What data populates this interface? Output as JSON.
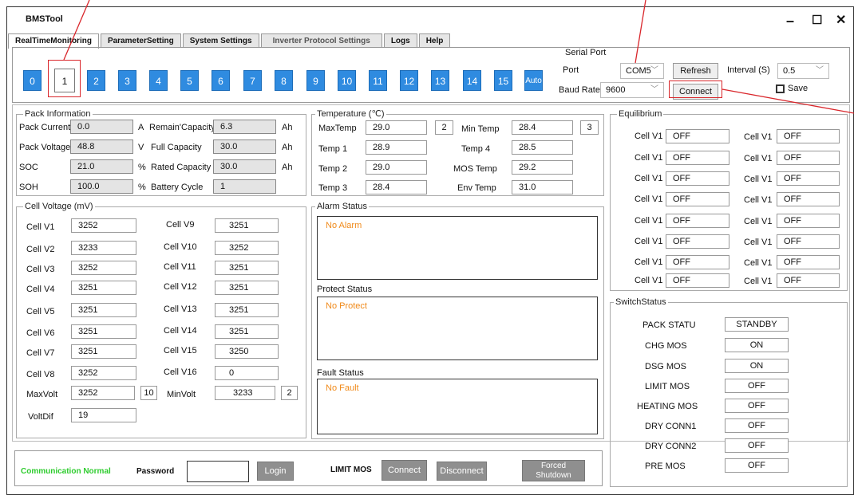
{
  "window": {
    "title": "BMSTool",
    "minimize": "–",
    "maximize": "☐",
    "close": "✕"
  },
  "tabs": [
    "RealTimeMonitoring",
    "ParameterSetting",
    "System Settings",
    "Inverter Protocol Settings",
    "Logs",
    "Help"
  ],
  "number_buttons": [
    "0",
    "1",
    "2",
    "3",
    "4",
    "5",
    "6",
    "7",
    "8",
    "9",
    "10",
    "11",
    "12",
    "13",
    "14",
    "15",
    "Auto"
  ],
  "selected_number": "1",
  "serial_port": {
    "title": "Serial Port",
    "port_label": "Port",
    "port_value": "COM5",
    "refresh": "Refresh",
    "interval_label": "Interval (S)",
    "interval_value": "0.5",
    "baud_label": "Baud Rate",
    "baud_value": "9600",
    "connect": "Connect",
    "save_label": "Save"
  },
  "pack_info": {
    "title": "Pack Information",
    "rows": [
      {
        "l1": "Pack Current",
        "v1": "0.0",
        "u1": "A",
        "l2": "Remain'Capacity",
        "v2": "6.3",
        "u2": "Ah"
      },
      {
        "l1": "Pack Voltage",
        "v1": "48.8",
        "u1": "V",
        "l2": "Full Capacity",
        "v2": "30.0",
        "u2": "Ah"
      },
      {
        "l1": "SOC",
        "v1": "21.0",
        "u1": "%",
        "l2": "Rated Capacity",
        "v2": "30.0",
        "u2": "Ah"
      },
      {
        "l1": "SOH",
        "v1": "100.0",
        "u1": "%",
        "l2": "Battery Cycle",
        "v2": "1",
        "u2": ""
      }
    ]
  },
  "temperature": {
    "title": "Temperature (℃)",
    "maxtemp_label": "MaxTemp",
    "maxtemp": "29.0",
    "maxtemp_idx": "2",
    "mintemp_label": "Min Temp",
    "mintemp": "28.4",
    "mintemp_idx": "3",
    "t1_label": "Temp 1",
    "t1": "28.9",
    "t4_label": "Temp 4",
    "t4": "28.5",
    "t2_label": "Temp 2",
    "t2": "29.0",
    "mos_label": "MOS Temp",
    "mos": "29.2",
    "t3_label": "Temp 3",
    "t3": "28.4",
    "env_label": "Env Temp",
    "env": "31.0"
  },
  "cell_voltage": {
    "title": "Cell Voltage (mV)",
    "left": [
      {
        "label": "Cell V1",
        "value": "3252"
      },
      {
        "label": "Cell V2",
        "value": "3233"
      },
      {
        "label": "Cell V3",
        "value": "3252"
      },
      {
        "label": "Cell V4",
        "value": "3251"
      },
      {
        "label": "Cell V5",
        "value": "3251"
      },
      {
        "label": "Cell V6",
        "value": "3251"
      },
      {
        "label": "Cell V7",
        "value": "3251"
      },
      {
        "label": "Cell V8",
        "value": "3252"
      }
    ],
    "right": [
      {
        "label": "Cell V9",
        "value": "3251"
      },
      {
        "label": "Cell V10",
        "value": "3252"
      },
      {
        "label": "Cell V11",
        "value": "3251"
      },
      {
        "label": "Cell V12",
        "value": "3251"
      },
      {
        "label": "Cell V13",
        "value": "3251"
      },
      {
        "label": "Cell V14",
        "value": "3251"
      },
      {
        "label": "Cell V15",
        "value": "3250"
      },
      {
        "label": "Cell V16",
        "value": "0"
      }
    ],
    "maxvolt_label": "MaxVolt",
    "maxvolt": "3252",
    "maxvolt_idx": "10",
    "minvolt_label": "MinVolt",
    "minvolt": "3233",
    "minvolt_idx": "2",
    "voltdif_label": "VoltDif",
    "voltdif": "19"
  },
  "alarm": {
    "title": "Alarm Status",
    "text": "No Alarm"
  },
  "protect": {
    "title": "Protect Status",
    "text": "No Protect"
  },
  "fault": {
    "title": "Fault Status",
    "text": "No Fault"
  },
  "equilibrium": {
    "title": "Equilibrium",
    "rows": [
      {
        "l1": "Cell V1",
        "v1": "OFF",
        "l2": "Cell V1",
        "v2": "OFF"
      },
      {
        "l1": "Cell V1",
        "v1": "OFF",
        "l2": "Cell V1",
        "v2": "OFF"
      },
      {
        "l1": "Cell V1",
        "v1": "OFF",
        "l2": "Cell V1",
        "v2": "OFF"
      },
      {
        "l1": "Cell V1",
        "v1": "OFF",
        "l2": "Cell V1",
        "v2": "OFF"
      },
      {
        "l1": "Cell V1",
        "v1": "OFF",
        "l2": "Cell V1",
        "v2": "OFF"
      },
      {
        "l1": "Cell V1",
        "v1": "OFF",
        "l2": "Cell V1",
        "v2": "OFF"
      },
      {
        "l1": "Cell V1",
        "v1": "OFF",
        "l2": "Cell V1",
        "v2": "OFF"
      },
      {
        "l1": "Cell V1",
        "v1": "OFF",
        "l2": "Cell V1",
        "v2": "OFF"
      }
    ]
  },
  "switch_status": {
    "title": "SwitchStatus",
    "rows": [
      {
        "label": "PACK STATU",
        "value": "STANDBY"
      },
      {
        "label": "CHG MOS",
        "value": "ON"
      },
      {
        "label": "DSG MOS",
        "value": "ON"
      },
      {
        "label": "LIMIT MOS",
        "value": "OFF"
      },
      {
        "label": "HEATING MOS",
        "value": "OFF"
      },
      {
        "label": "DRY CONN1",
        "value": "OFF"
      },
      {
        "label": "DRY CONN2",
        "value": "OFF"
      },
      {
        "label": "PRE MOS",
        "value": "OFF"
      }
    ]
  },
  "bottom": {
    "comm_status": "Communication Normal",
    "password_label": "Password",
    "password_value": "",
    "login": "Login",
    "limit_mos_label": "LIMIT MOS",
    "connect": "Connect",
    "disconnect": "Disconnect",
    "forced_shutdown": "Forced Shutdown"
  },
  "colors": {
    "accent_blue": "#2f8be0",
    "status_green": "#2ecc2e",
    "alarm_orange": "#f08a1a",
    "annotation_red": "#d9262b"
  }
}
